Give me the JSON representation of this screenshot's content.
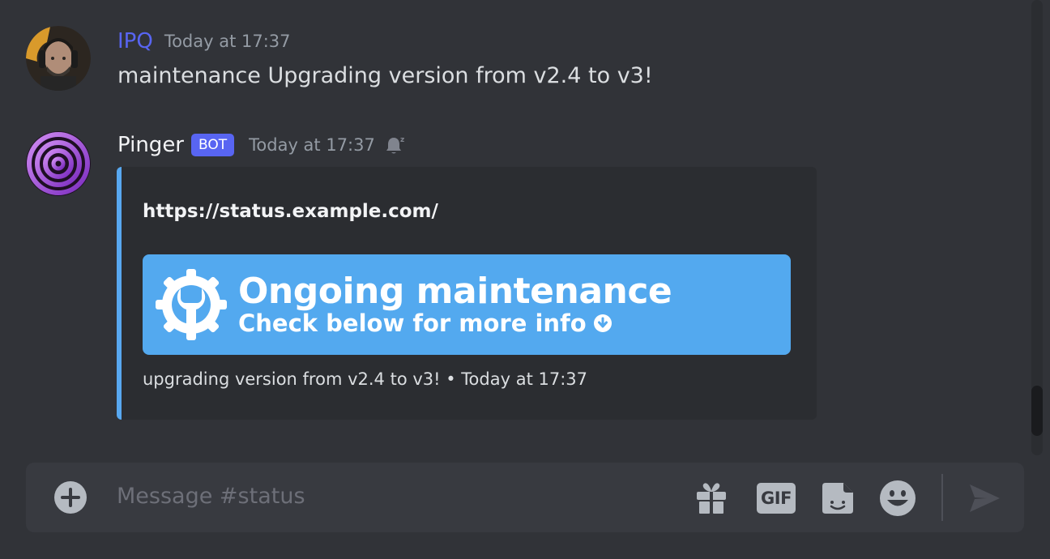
{
  "messages": [
    {
      "author": "IPQ",
      "author_color": "#5865f2",
      "timestamp": "Today at 17:37",
      "text": "maintenance Upgrading version from v2.4 to v3!"
    },
    {
      "author": "Pinger",
      "author_color": "#f2f3f5",
      "bot_tag": "BOT",
      "timestamp": "Today at 17:37",
      "status_icon": "bell-snooze-icon",
      "embed": {
        "url": "https://status.example.com/",
        "accent_color": "#58a8f0",
        "banner": {
          "title": "Ongoing maintenance",
          "subtitle": "Check below for more info",
          "background": "#53a9ef",
          "icon": "wrench-gear-icon"
        },
        "footer": "upgrading version from v2.4 to v3! • Today at 17:37"
      }
    }
  ],
  "composer": {
    "placeholder": "Message #status",
    "buttons": [
      "add-attachment-icon",
      "gift-icon",
      "gif-icon",
      "sticker-icon",
      "emoji-icon",
      "send-icon"
    ],
    "gif_label": "GIF"
  }
}
